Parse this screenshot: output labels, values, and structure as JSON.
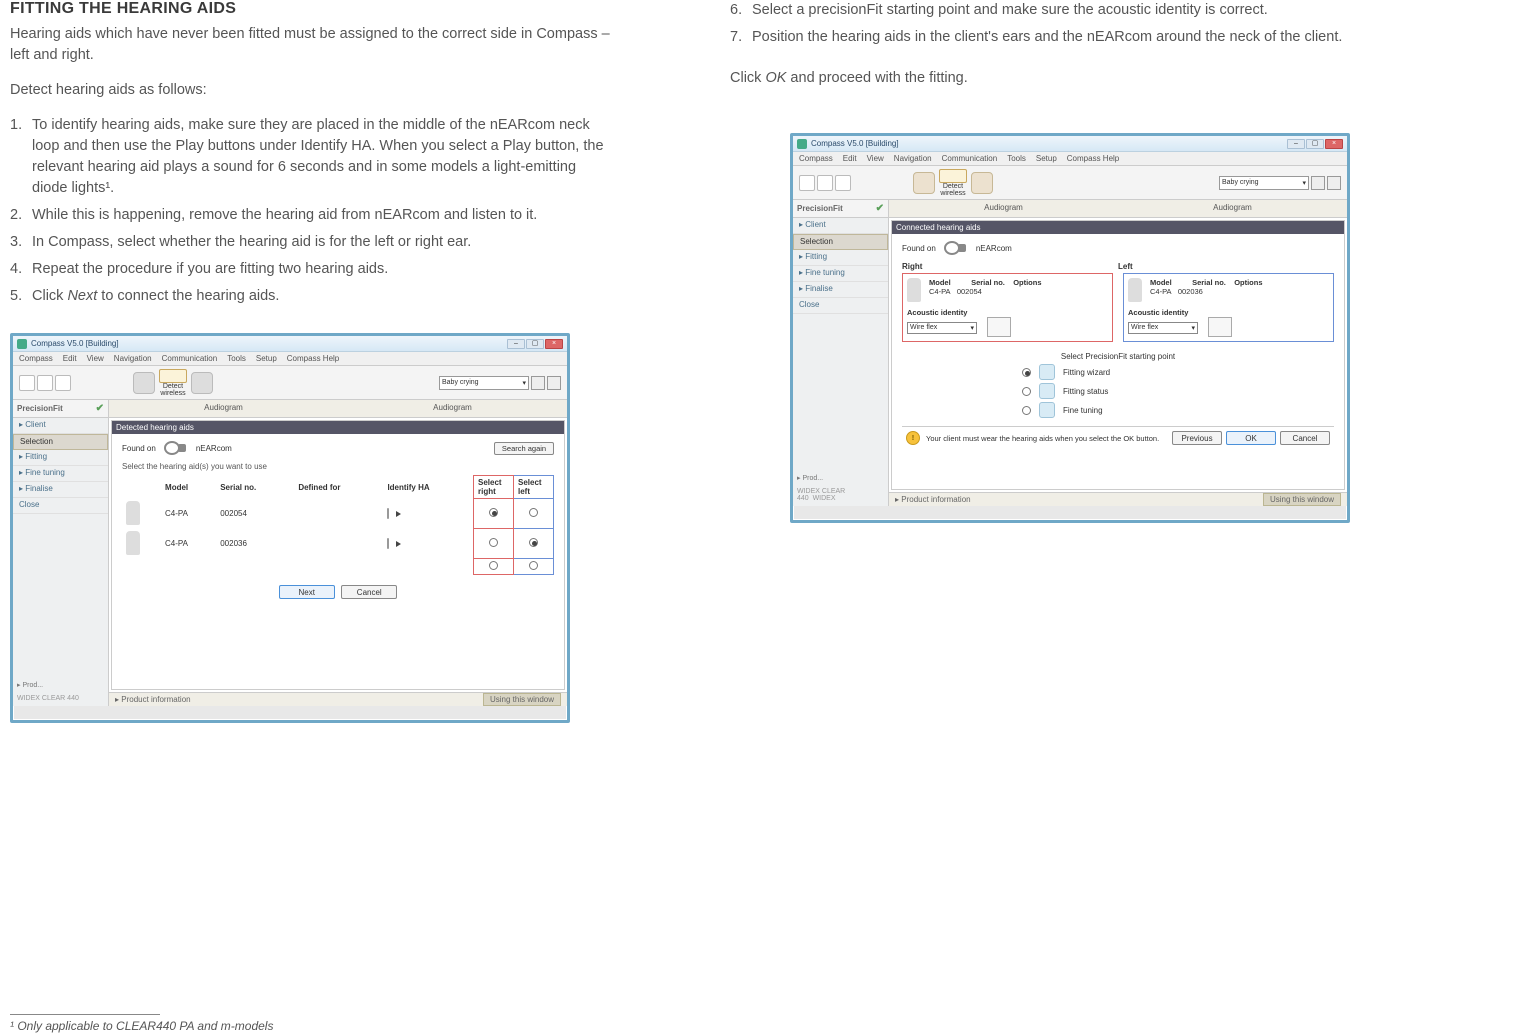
{
  "left": {
    "heading": "FITTING THE HEARING AIDS",
    "intro1": "Hearing aids which have never been fitted must be assigned to the correct side in Compass – left and right.",
    "intro2": "Detect hearing aids as follows:",
    "steps": [
      "To identify hearing aids, make sure they are placed in the middle of the nEARcom neck loop and then use the Play buttons under Identify HA. When you select a Play button, the relevant hearing aid plays a sound for 6 seconds and in some models a light-emitting diode lights¹.",
      "While this is happening, remove the hearing aid from nEARcom and listen to it.",
      "In Compass, select whether the hearing aid is for the left or right ear.",
      "Repeat the procedure if you are fitting two hearing aids.",
      "Click Next to connect the hearing aids."
    ],
    "footnote": "¹  Only applicable to CLEAR440 PA and m-models"
  },
  "right": {
    "steps": [
      "Select a precisionFit starting point and make sure the acoustic identity is correct.",
      "Position the hearing aids in the client's ears and the nEARcom around the neck of the client."
    ],
    "startNum": 6,
    "outro": "Click OK and proceed with the fitting."
  },
  "app": {
    "title": "Compass V5.0 [Building]",
    "menus": [
      "Compass",
      "Edit",
      "View",
      "Navigation",
      "Communication",
      "Tools",
      "Setup",
      "Compass Help"
    ],
    "detectLabel": "Detect",
    "detectSub": "wireless",
    "combo": "Baby crying",
    "sidebar": {
      "precisionFit": "PrecisionFit",
      "items": [
        "▸ Client",
        "Selection",
        "▸ Fitting",
        "▸ Fine tuning",
        "▸ Finalise",
        "  Close"
      ],
      "brand1": "WIDEX CLEAR 440",
      "brand2": "WIDEX"
    },
    "audiogram": "Audiogram",
    "prodInfo": "▸ Product information",
    "usingWindow": "Using this window"
  },
  "screen1": {
    "panelTitle": "Detected hearing aids",
    "foundOn": "Found on",
    "nEARcom": "nEARcom",
    "searchAgain": "Search again",
    "selectLine": "Select the hearing aid(s) you want to use",
    "headers": [
      "",
      "Model",
      "Serial no.",
      "Defined for",
      "Identify HA",
      "Select right",
      "Select left"
    ],
    "rows": [
      {
        "model": "C4-PA",
        "serial": "002054",
        "right": true,
        "left": false
      },
      {
        "model": "C4-PA",
        "serial": "002036",
        "right": false,
        "left": true
      }
    ],
    "btnNext": "Next",
    "btnCancel": "Cancel"
  },
  "screen2": {
    "panelTitle": "Connected hearing aids",
    "foundOn": "Found on",
    "nEARcom": "nEARcom",
    "rightLabel": "Right",
    "leftLabel": "Left",
    "hdrs": [
      "Model",
      "Serial no.",
      "Options"
    ],
    "right": {
      "model": "C4-PA",
      "serial": "002054"
    },
    "left": {
      "model": "C4-PA",
      "serial": "002036"
    },
    "acousticIdentity": "Acoustic identity",
    "wireflex": "Wire flex",
    "startLabel": "Select PrecisionFit starting point",
    "opts": [
      "Fitting wizard",
      "Fitting status",
      "Fine tuning"
    ],
    "warn": "Your client must wear the hearing aids when you select the OK button.",
    "btnPrev": "Previous",
    "btnOK": "OK",
    "btnCancel": "Cancel"
  }
}
